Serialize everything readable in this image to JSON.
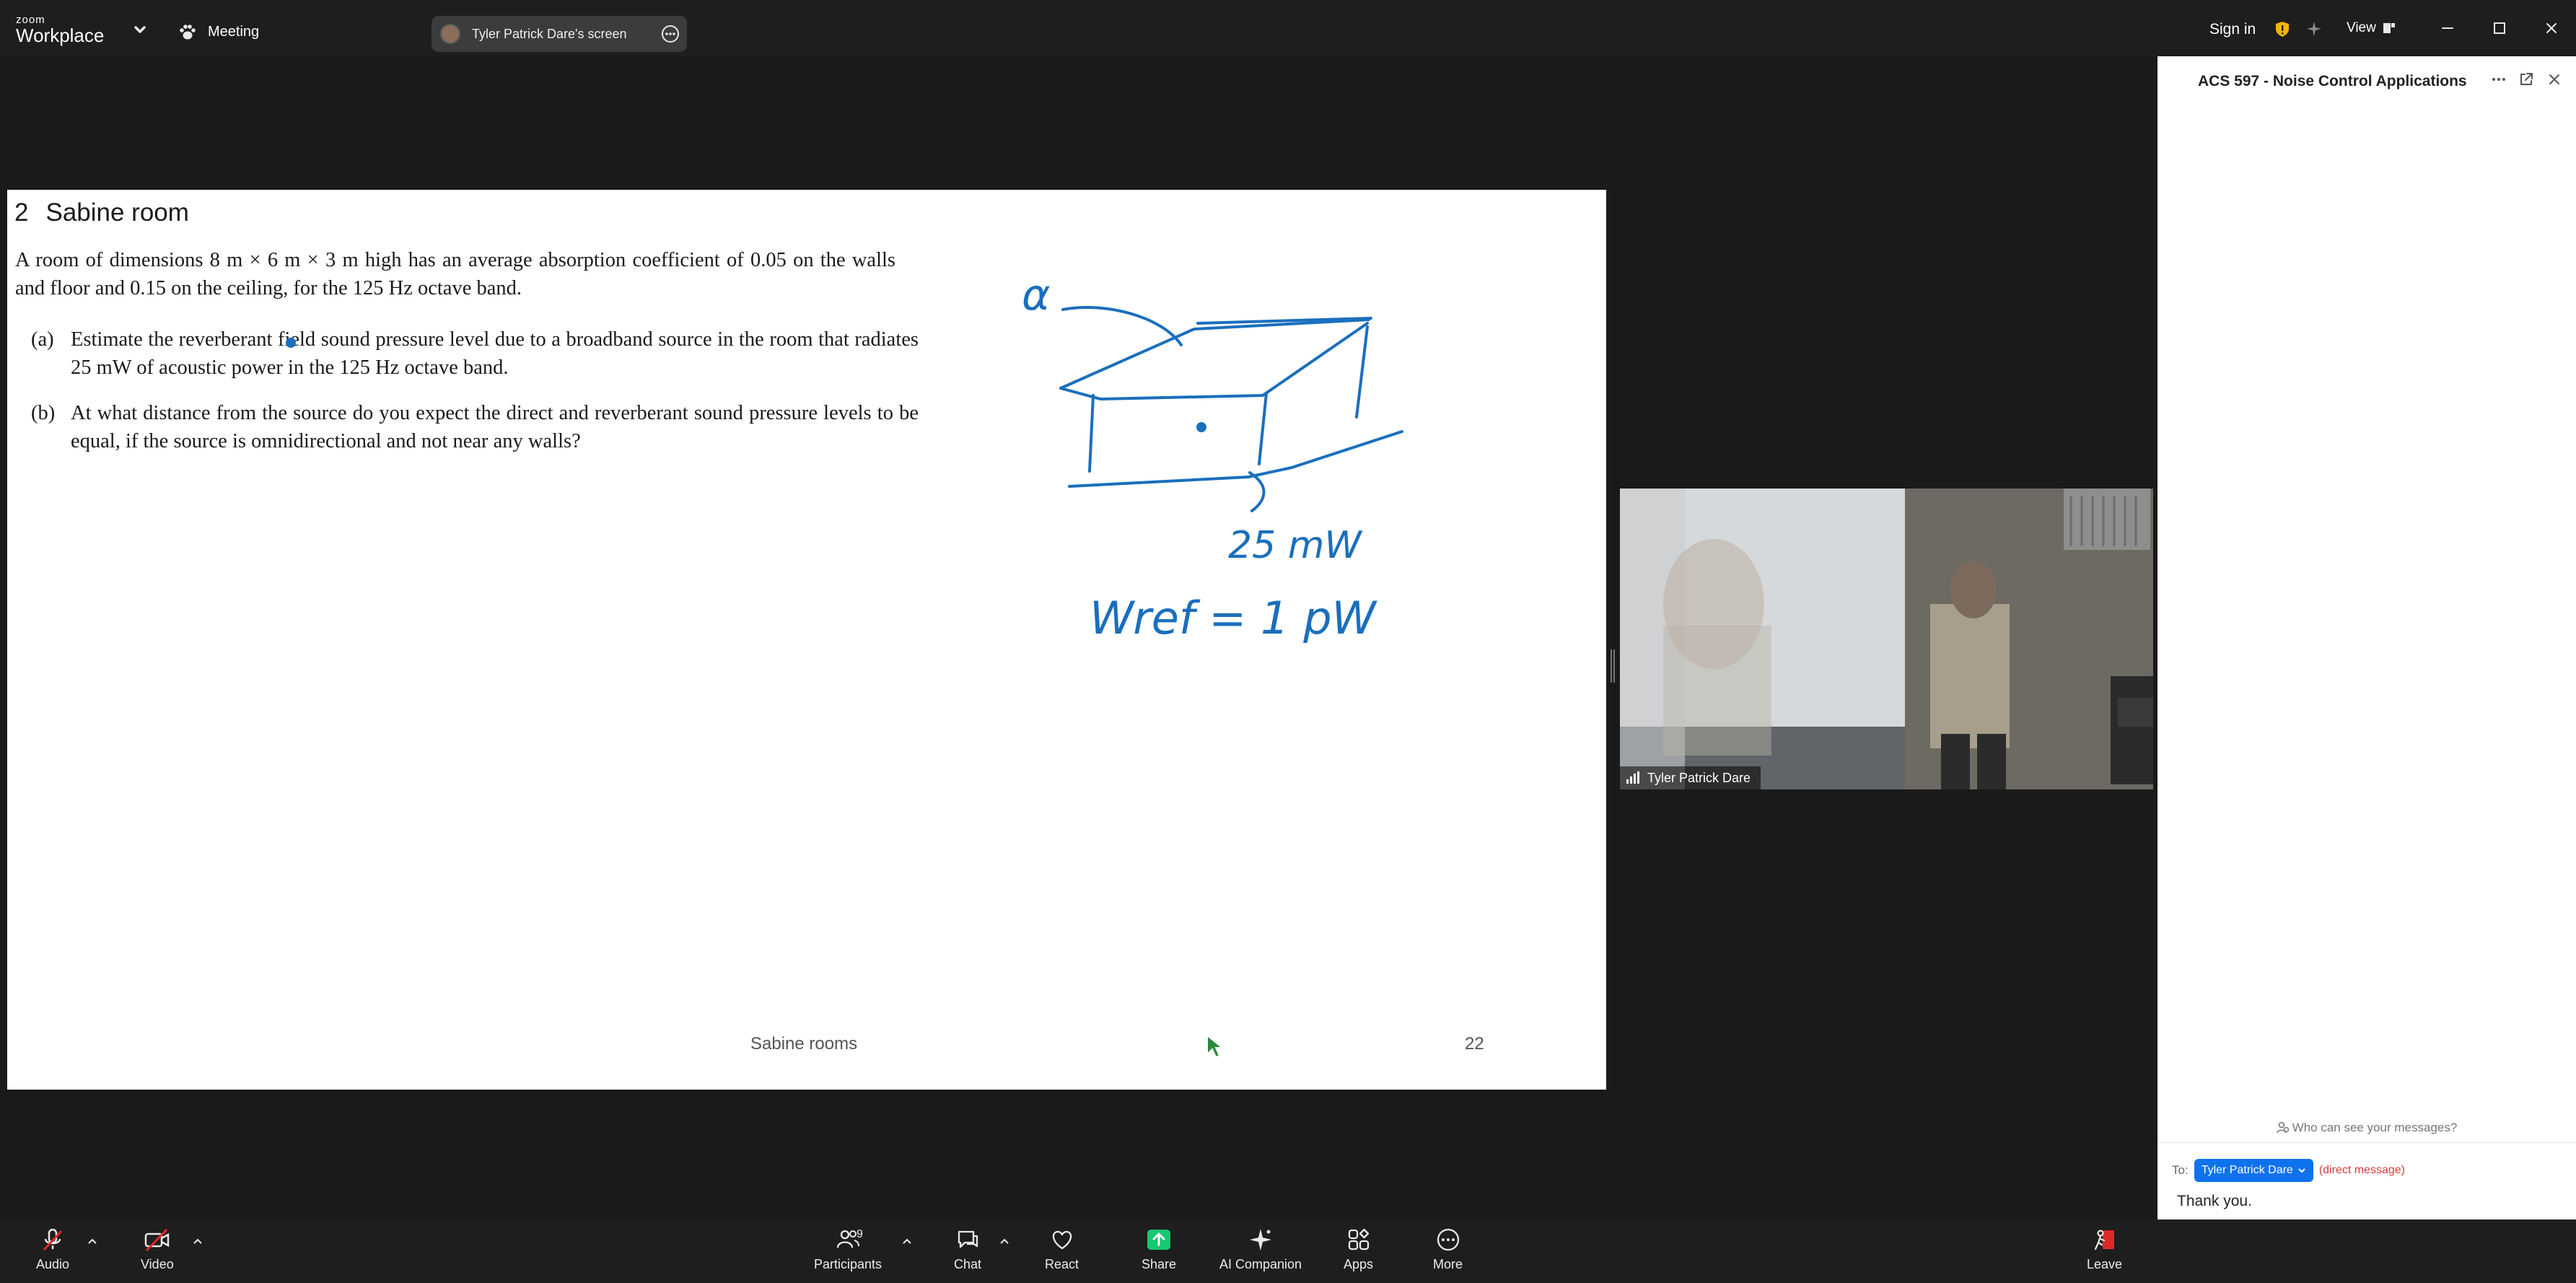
{
  "app": {
    "logo_line1": "zoom",
    "logo_line2": "Workplace",
    "meeting_label": "Meeting",
    "screen_share_label": "Tyler Patrick Dare's screen",
    "sign_in": "Sign in",
    "view_label": "View"
  },
  "slide": {
    "section_number": "2",
    "title": "Sabine room",
    "intro": "A room of dimensions 8 m × 6 m × 3 m high has an average absorption coefficient of 0.05 on the walls and floor and 0.15 on the ceiling, for the 125 Hz octave band.",
    "questions": [
      {
        "label": "(a)",
        "text": "Estimate the reverberant field sound pressure level due to a broadband source in the room that radiates 25 mW of acoustic power in the 125 Hz octave band."
      },
      {
        "label": "(b)",
        "text": "At what distance from the source do you expect the direct and reverberant sound pressure levels to be equal, if the source is omnidirectional and not near any walls?"
      }
    ],
    "footer": "Sabine rooms",
    "page_number": "22",
    "annotations": {
      "alpha": "α",
      "power": "25 mW",
      "reference": "Wref = 1 pW"
    },
    "annotation_color": "#1a6fbd"
  },
  "video": {
    "participant_name": "Tyler Patrick Dare"
  },
  "chat": {
    "title": "ACS 597 - Noise Control Applications",
    "who_can_see": "Who can see your messages?",
    "to_label": "To:",
    "recipient": "Tyler Patrick Dare",
    "direct_message": "(direct message)",
    "message_text": "Thank you."
  },
  "toolbar": {
    "audio": "Audio",
    "video": "Video",
    "participants": "Participants",
    "participants_count": "9",
    "chat": "Chat",
    "react": "React",
    "share": "Share",
    "ai_companion": "AI Companion",
    "apps": "Apps",
    "more": "More",
    "leave": "Leave",
    "share_color": "#18c76f",
    "leave_color": "#e02828"
  }
}
